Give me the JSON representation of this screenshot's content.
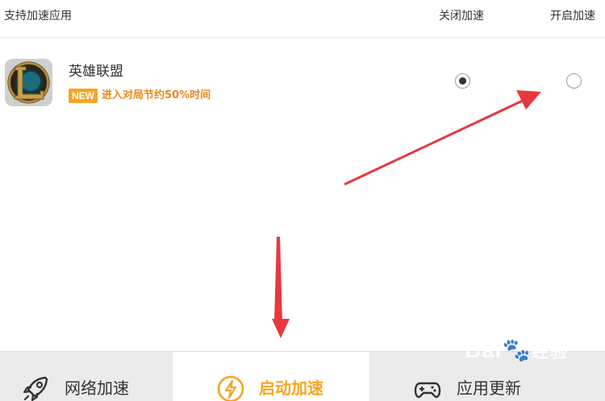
{
  "header": {
    "supported_apps": "支持加速应用",
    "disable_accel": "关闭加速",
    "enable_accel": "开启加速"
  },
  "app": {
    "name": "英雄联盟",
    "badge": "NEW",
    "promo": "进入对局节约50%时间",
    "icon": "league-of-legends-icon",
    "accel_selected": "off"
  },
  "bottom_tabs": [
    {
      "label": "网络加速",
      "icon": "rocket-icon",
      "active": false
    },
    {
      "label": "启动加速",
      "icon": "lightning-icon",
      "active": true
    },
    {
      "label": "应用更新",
      "icon": "gamepad-icon",
      "active": false
    }
  ],
  "watermark": {
    "latin": "Bai",
    "cn": "经验",
    "brand": "baidu-watermark"
  },
  "colors": {
    "accent": "#f5a623",
    "promo": "#e8891b",
    "arrow": "#e8383d",
    "tab_bar": "#ebebeb"
  }
}
